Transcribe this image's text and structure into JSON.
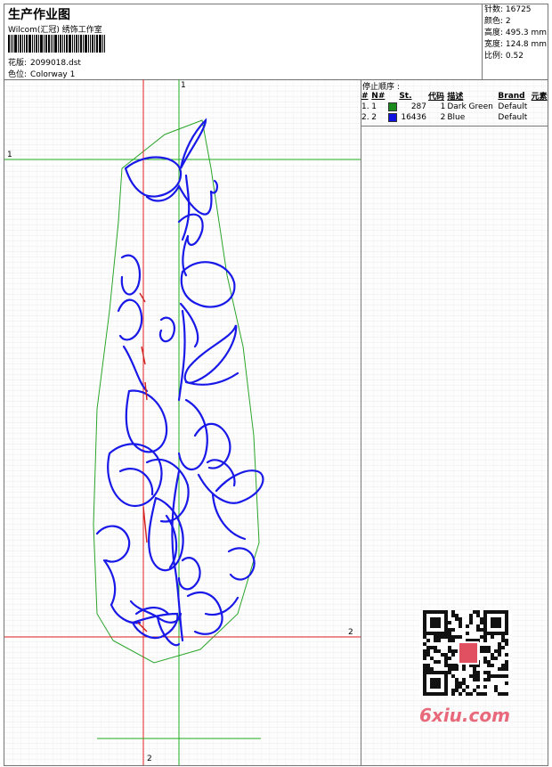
{
  "header": {
    "title": "生产作业图",
    "company": "Wilcom(汇冠) 绣饰工作室",
    "design_label": "花版:",
    "design_file": "2099018.dst",
    "color_label": "色位:",
    "colorway": "Colorway 1"
  },
  "stats": {
    "stitches": "针数: 16725",
    "colors": "颜色: 2",
    "height": "高度: 495.3 mm",
    "width": "宽度: 124.8 mm",
    "scale": "比例: 0.52"
  },
  "stop_sequence": {
    "title": "停止顺序 :",
    "headers": [
      "#",
      "N#",
      "St.",
      "代码",
      "描述",
      "Brand",
      "元素"
    ],
    "rows": [
      {
        "index": "1.",
        "needle": "1",
        "stitches": "287",
        "code": "1",
        "description": "Dark Green",
        "brand": "Default",
        "color": "#1a8a1a"
      },
      {
        "index": "2.",
        "needle": "2",
        "stitches": "16436",
        "code": "2",
        "description": "Blue",
        "brand": "Default",
        "color": "#1010e0"
      }
    ]
  },
  "guides": {
    "top_label": "1",
    "left_label": "1",
    "right_label": "2",
    "bottom_label": "2"
  },
  "watermark": "6xiu.com"
}
